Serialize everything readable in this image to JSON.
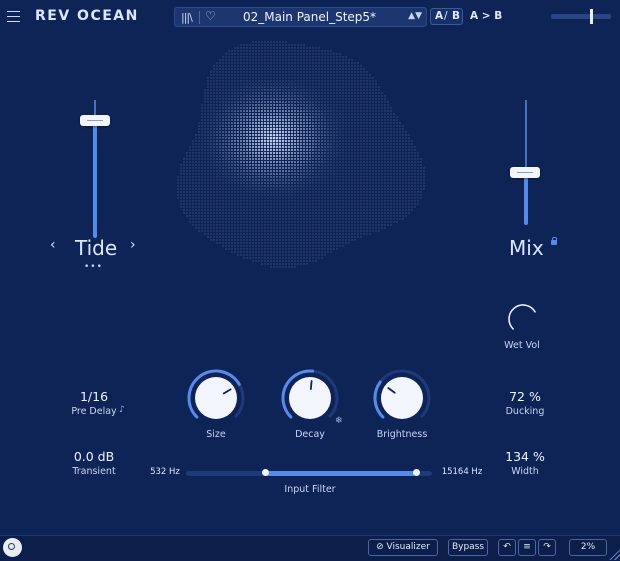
{
  "app": {
    "title": "REV OCEAN"
  },
  "preset": {
    "name": "02_Main Panel_Step5*",
    "library_icon": "library-icon",
    "favorite_icon": "heart-icon"
  },
  "ab": {
    "a": "A",
    "slash": "/",
    "b": "B",
    "copy": "A > B"
  },
  "output_meter": {
    "level": 0.68
  },
  "tide": {
    "label": "Tide",
    "prev": "‹",
    "next": "›",
    "dots": "•••",
    "fader_level": 0.82
  },
  "mix": {
    "label": "Mix",
    "fader_level": 0.55,
    "lock_icon": "lock-icon"
  },
  "wet_vol": {
    "label": "Wet Vol",
    "level": 0.72
  },
  "pre_delay": {
    "value": "1/16",
    "label": "Pre Delay",
    "note_icon": "♪"
  },
  "transient": {
    "value": "0.0 dB",
    "label": "Transient"
  },
  "size": {
    "label": "Size",
    "level": 0.72
  },
  "decay": {
    "label": "Decay",
    "level": 0.52,
    "freeze_icon": "❄"
  },
  "brightness": {
    "label": "Brightness",
    "level": 0.3
  },
  "ducking": {
    "value": "72 %",
    "label": "Ducking"
  },
  "width": {
    "value": "134 %",
    "label": "Width"
  },
  "input_filter": {
    "label": "Input Filter",
    "low": "532 Hz",
    "high": "15164 Hz"
  },
  "bottom": {
    "visualizer": "Visualizer",
    "bypass": "Bypass",
    "zoom": "2%",
    "undo_icon": "undo-icon",
    "list_icon": "list-icon",
    "redo_icon": "redo-icon"
  },
  "colors": {
    "background": "#0e2456",
    "accent": "#5a8ae8",
    "text": "#e8f0ff"
  }
}
